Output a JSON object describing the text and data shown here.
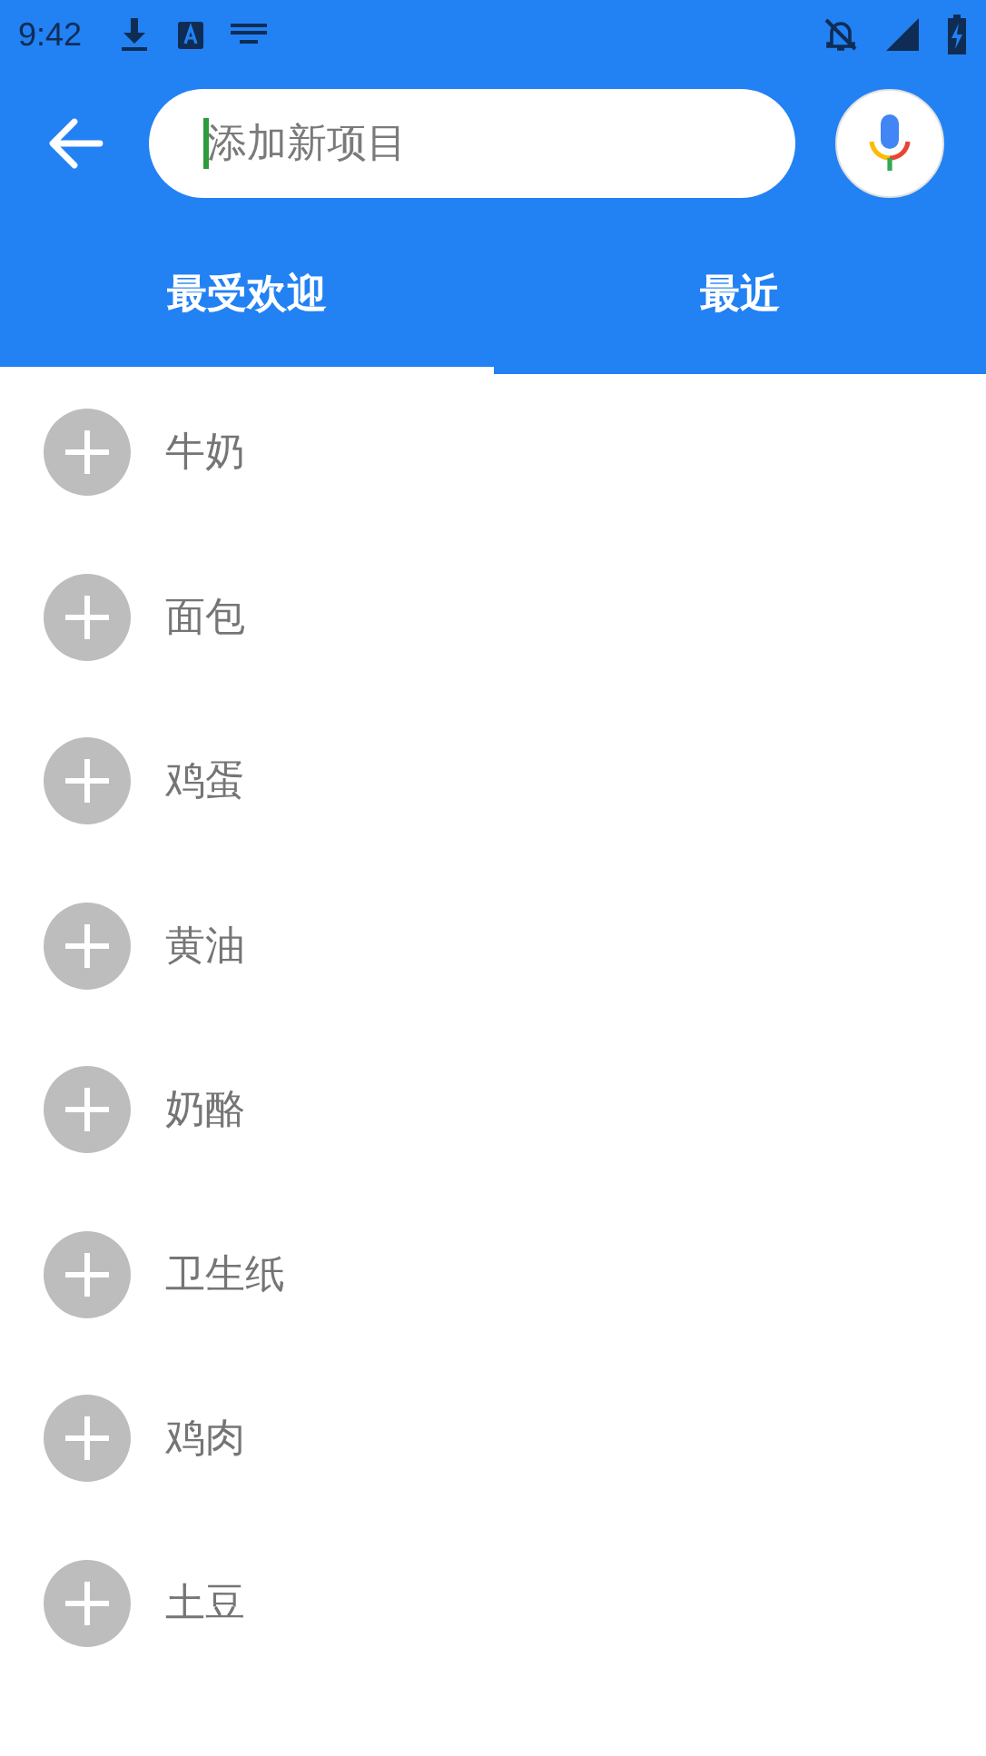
{
  "status_bar": {
    "time": "9:42"
  },
  "search": {
    "placeholder": "添加新项目"
  },
  "tabs": [
    {
      "label": "最受欢迎",
      "selected": true
    },
    {
      "label": "最近",
      "selected": false
    }
  ],
  "items": [
    {
      "label": "牛奶"
    },
    {
      "label": "面包"
    },
    {
      "label": "鸡蛋"
    },
    {
      "label": "黄油"
    },
    {
      "label": "奶酪"
    },
    {
      "label": "卫生纸"
    },
    {
      "label": "鸡肉"
    },
    {
      "label": "土豆"
    }
  ]
}
